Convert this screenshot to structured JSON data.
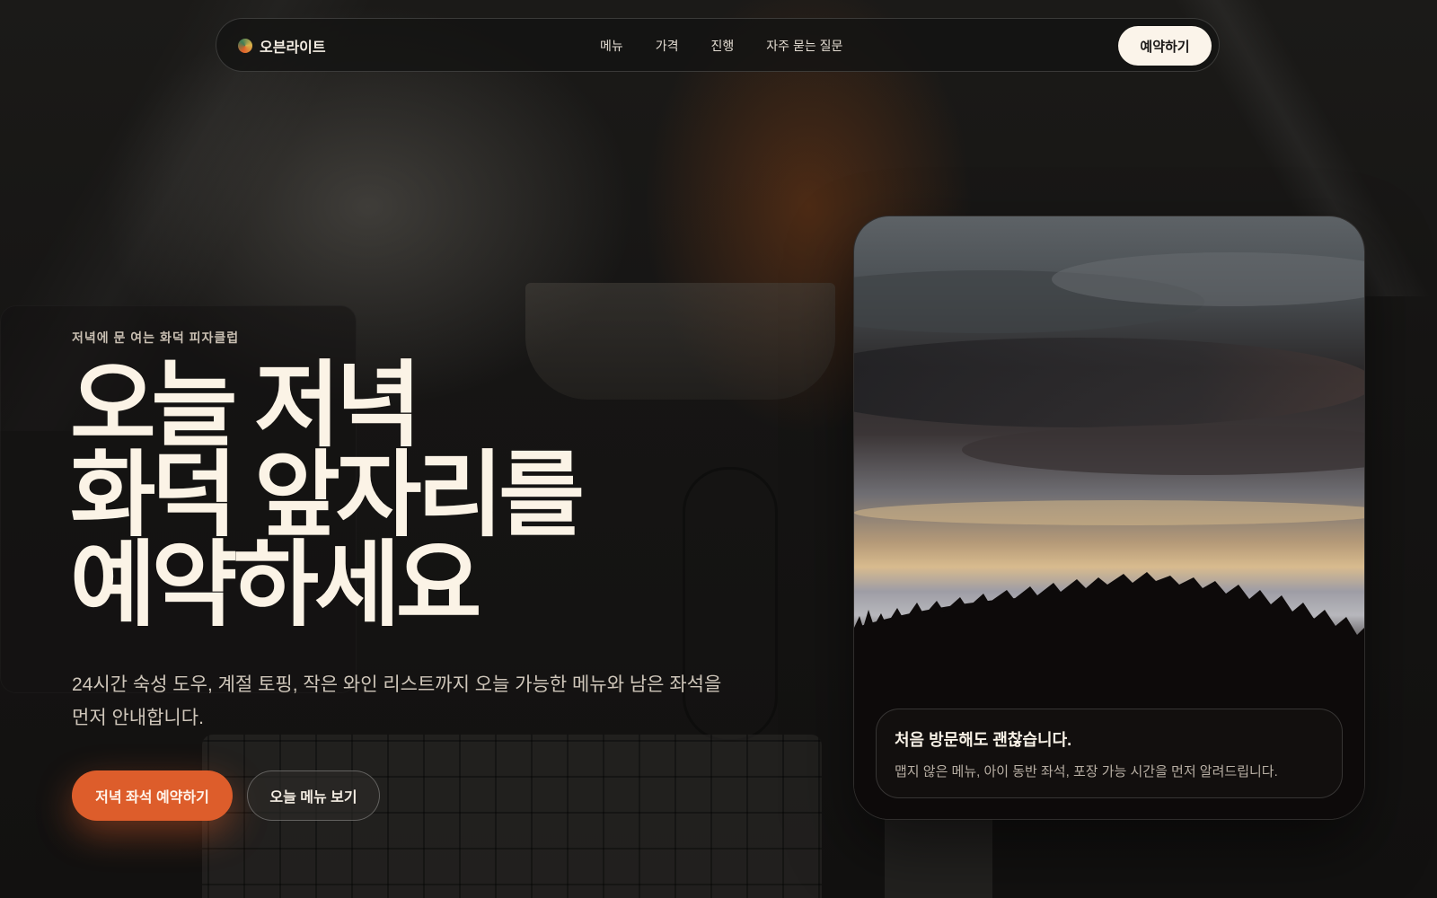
{
  "nav": {
    "brand": "오븐라이트",
    "links": [
      "메뉴",
      "가격",
      "진행",
      "자주 묻는 질문"
    ],
    "cta": "예약하기"
  },
  "hero": {
    "eyebrow": "저녁에 문 여는 화덕 피자클럽",
    "headline": [
      "오늘 저녁",
      "화덕 앞자리를",
      "예약하세요"
    ],
    "subtext": "24시간 숙성 도우, 계절 토핑, 작은 와인 리스트까지 오늘 가능한 메뉴와 남은 좌석을 먼저 안내합니다.",
    "primary_button": "저녁 좌석 예약하기",
    "secondary_button": "오늘 메뉴 보기"
  },
  "card": {
    "title": "처음 방문해도 괜찮습니다.",
    "body": "맵지 않은 메뉴, 아이 동반 좌석, 포장 가능 시간을 먼저 알려드립니다."
  },
  "colors": {
    "accent": "#dd5d2b",
    "background": "#121110",
    "text": "#fbf3e6"
  }
}
